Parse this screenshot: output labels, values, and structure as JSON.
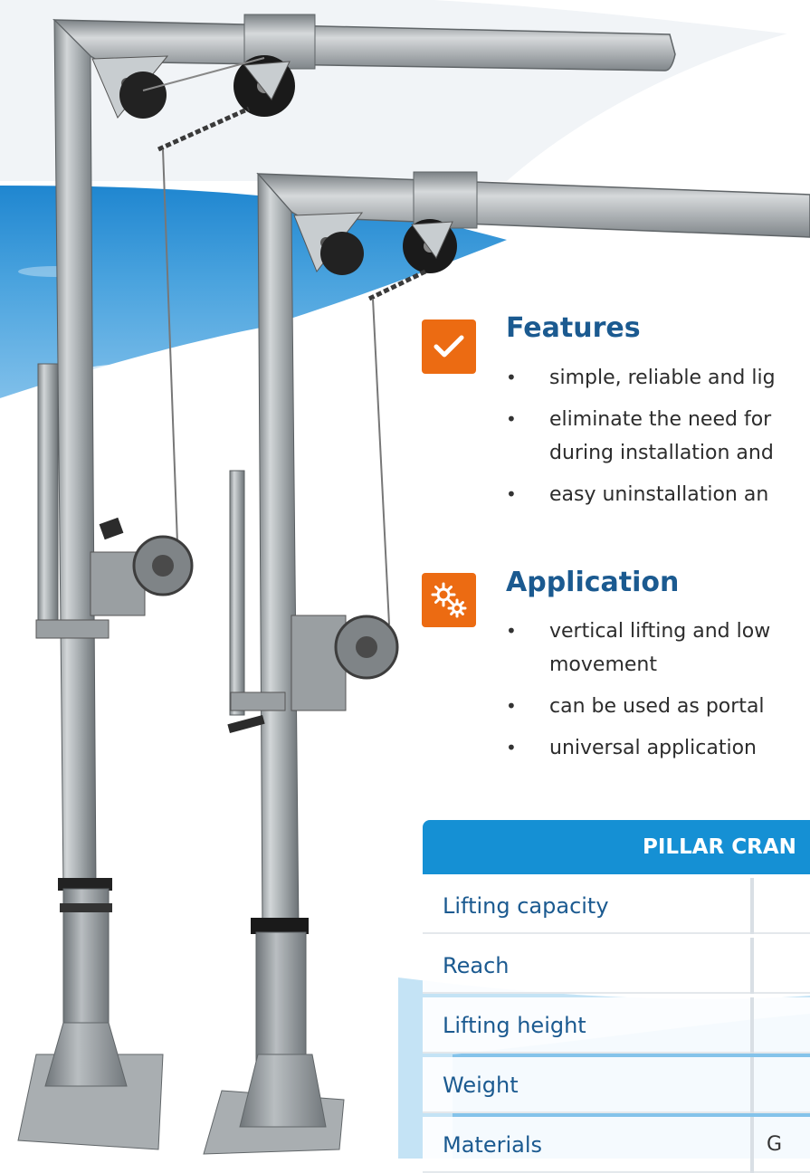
{
  "features": {
    "title": "Features",
    "icon": "checkmark-icon",
    "items": [
      "simple, reliable and lig",
      "eliminate the need for",
      "during installation and",
      "easy uninstallation an"
    ]
  },
  "application": {
    "title": "Application",
    "icon": "gears-icon",
    "items": [
      "vertical lifting and low",
      "movement",
      "can be used as portal",
      "universal application"
    ]
  },
  "specs": {
    "title": "PILLAR CRAN",
    "rows": [
      {
        "label": "Lifting capacity",
        "value": ""
      },
      {
        "label": "Reach",
        "value": ""
      },
      {
        "label": "Lifting height",
        "value": ""
      },
      {
        "label": "Weight",
        "value": ""
      },
      {
        "label": "Materials",
        "value": "G"
      }
    ]
  },
  "colors": {
    "accent": "#ec6b12",
    "heading": "#1b5a90",
    "table_header": "#1590d4",
    "sky": "#3f9ad8"
  }
}
